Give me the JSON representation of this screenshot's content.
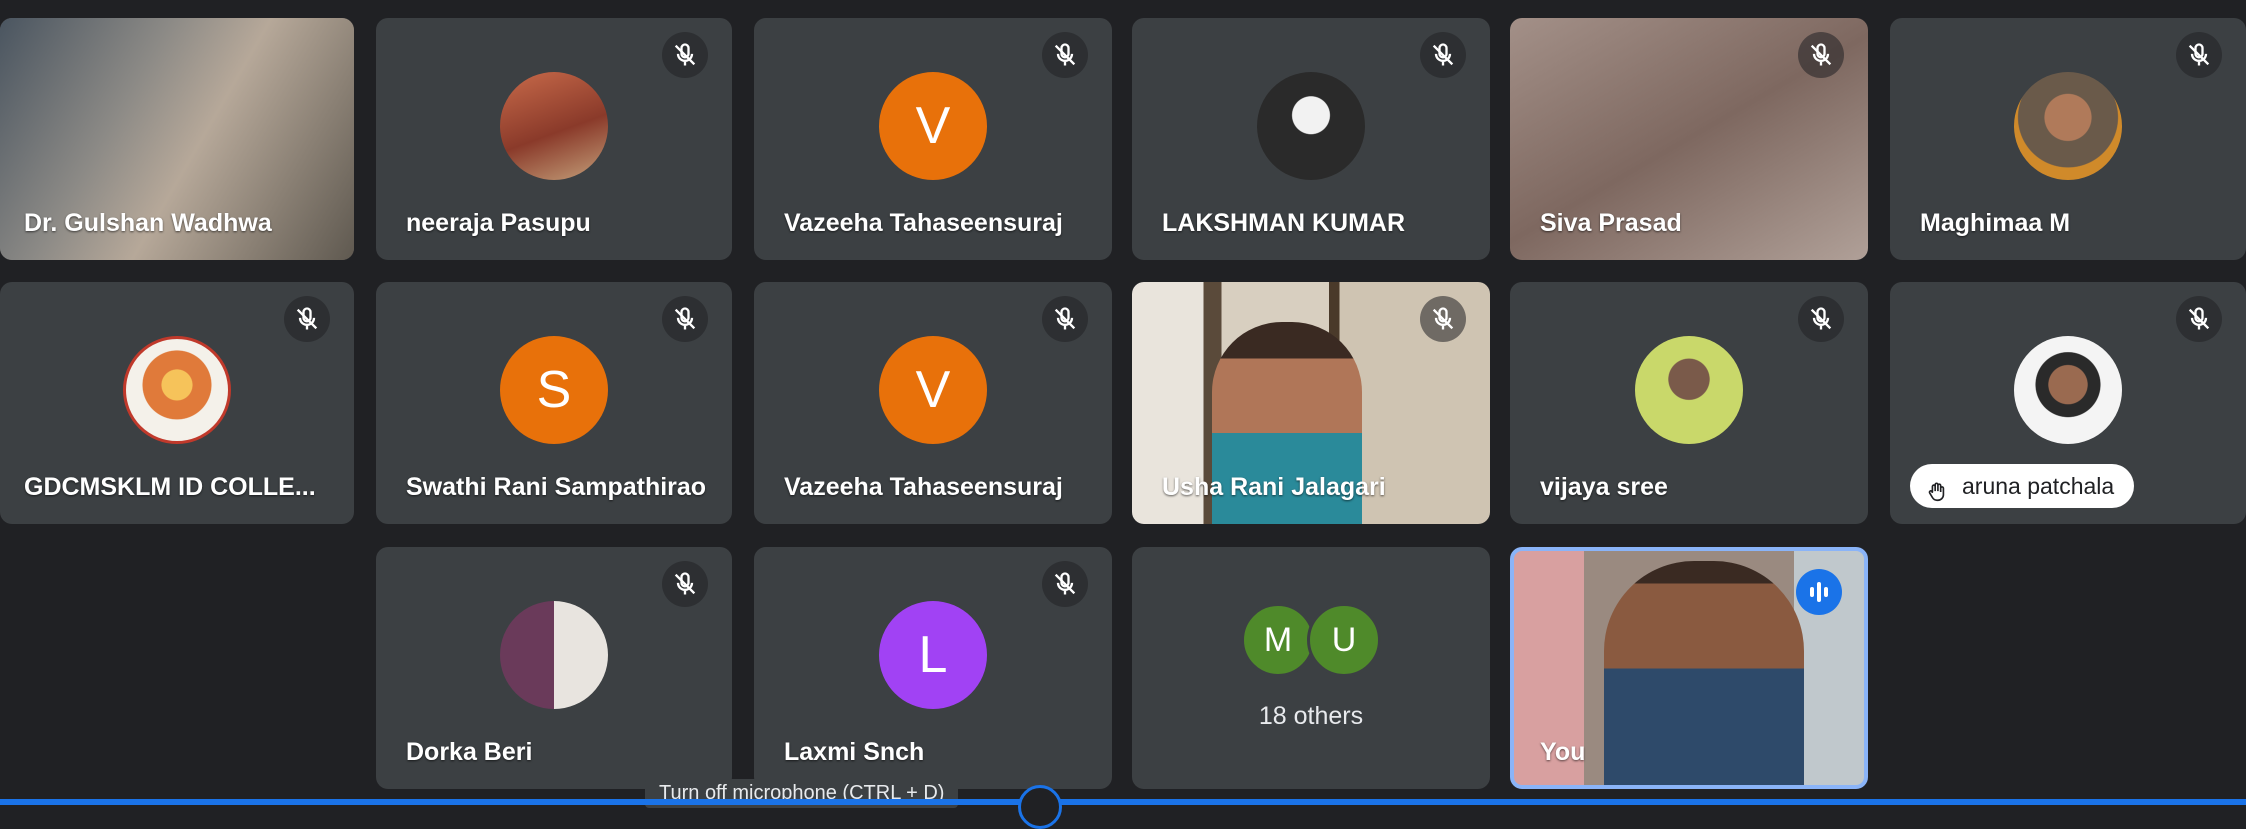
{
  "participants": [
    {
      "name": "Dr. Gulshan Wadhwa"
    },
    {
      "name": "neeraja Pasupu"
    },
    {
      "name": "Vazeeha Tahaseensuraj",
      "initial": "V"
    },
    {
      "name": "LAKSHMAN KUMAR"
    },
    {
      "name": "Siva Prasad"
    },
    {
      "name": "Maghimaa M"
    },
    {
      "name": "GDCMSKLM ID COLLE..."
    },
    {
      "name": "Swathi Rani Sampathirao",
      "initial": "S"
    },
    {
      "name": "Vazeeha Tahaseensuraj",
      "initial": "V"
    },
    {
      "name": "Usha Rani Jalagari"
    },
    {
      "name": "vijaya sree"
    },
    {
      "name": "aruna patchala"
    },
    {
      "name": "Dorka Beri"
    },
    {
      "name": "Laxmi Snch",
      "initial": "L"
    },
    {
      "name": "You"
    }
  ],
  "others": {
    "initials": [
      "M",
      "U"
    ],
    "label": "18 others"
  },
  "tooltip": "Turn off microphone (CTRL + D)",
  "colors": {
    "background": "#202124",
    "tile": "#3c4043",
    "avatar_orange": "#e8710a",
    "avatar_purple": "#a142f4",
    "others_green": "#4f8a2a",
    "active_blue": "#1a73e8"
  },
  "icons": {
    "muted": "mic-off-icon",
    "speaking": "audio-level-icon",
    "hand": "raise-hand-icon"
  }
}
